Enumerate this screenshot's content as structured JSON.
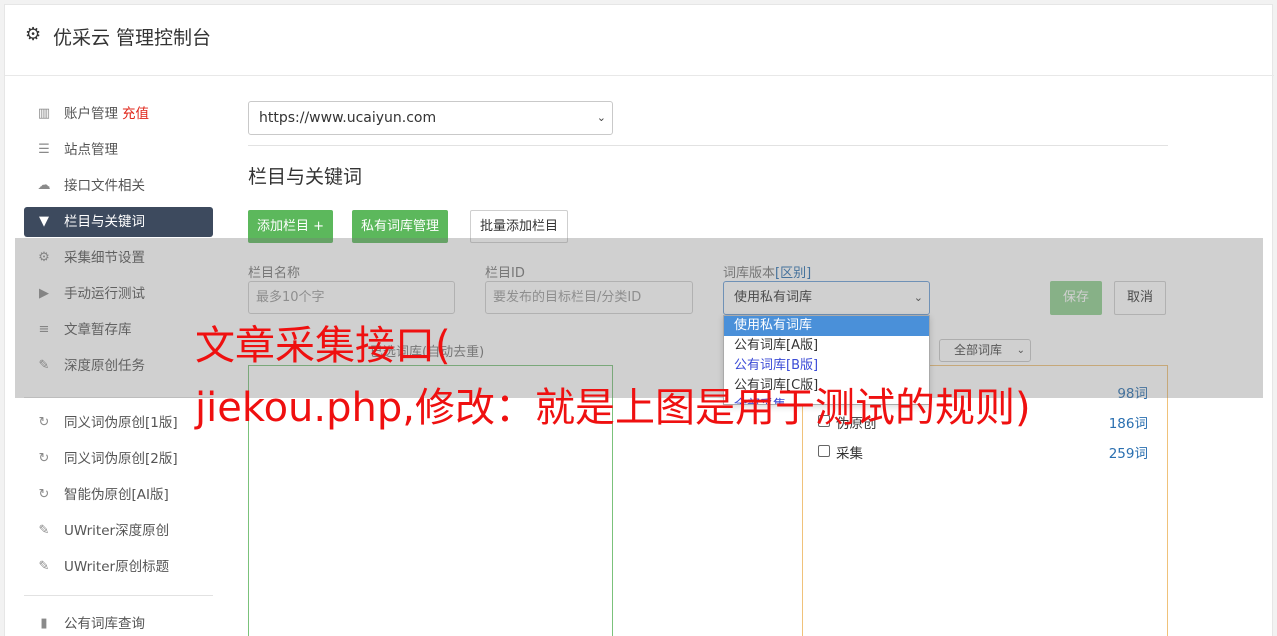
{
  "header": {
    "title": "优采云 管理控制台",
    "icon": "gear-icon"
  },
  "sidebar": {
    "items": [
      {
        "label": "账户管理",
        "icon": "bar-chart-icon",
        "extra": "充值"
      },
      {
        "label": "站点管理",
        "icon": "server-icon"
      },
      {
        "label": "接口文件相关",
        "icon": "cloud-upload-icon"
      },
      {
        "label": "栏目与关键词",
        "icon": "filter-icon",
        "active": true
      },
      {
        "label": "采集细节设置",
        "icon": "gears-icon"
      },
      {
        "label": "手动运行测试",
        "icon": "play-circle-icon"
      },
      {
        "label": "文章暂存库",
        "icon": "database-icon"
      },
      {
        "label": "深度原创任务",
        "icon": "edit-icon"
      },
      {
        "label": "同义词伪原创[1版]",
        "icon": "refresh-icon"
      },
      {
        "label": "同义词伪原创[2版]",
        "icon": "refresh-icon"
      },
      {
        "label": "智能伪原创[AI版]",
        "icon": "refresh-icon"
      },
      {
        "label": "UWriter深度原创",
        "icon": "edit-icon"
      },
      {
        "label": "UWriter原创标题",
        "icon": "edit-icon"
      },
      {
        "label": "公有词库查询",
        "icon": "book-icon"
      }
    ]
  },
  "main": {
    "site_select": "https://www.ucaiyun.com",
    "section_title": "栏目与关键词",
    "buttons": {
      "add_column": "添加栏目 +",
      "private_lib": "私有词库管理",
      "batch_add": "批量添加栏目"
    },
    "form": {
      "name_label": "栏目名称",
      "name_placeholder": "最多10个字",
      "id_label": "栏目ID",
      "id_placeholder": "要发布的目标栏目/分类ID",
      "lib_label": "词库版本",
      "lib_label_link": "[区别]",
      "lib_value": "使用私有词库",
      "save": "保存",
      "cancel": "取消"
    },
    "lib_options": [
      "使用私有词库",
      "公有词库[A版]",
      "公有词库[B版]",
      "公有词库[C版]",
      "全部采集"
    ],
    "keyword_box_label": "已选词库(自动去重)",
    "filter_select": "全部词库",
    "libraries": [
      {
        "name": "",
        "count": "98词"
      },
      {
        "name": "伪原创",
        "count": "186词"
      },
      {
        "name": "采集",
        "count": "259词"
      }
    ],
    "caption_line1": "文章采集接口(",
    "caption_line2": "jiekou.php,修改：就是上图是用于测试的规则)"
  }
}
